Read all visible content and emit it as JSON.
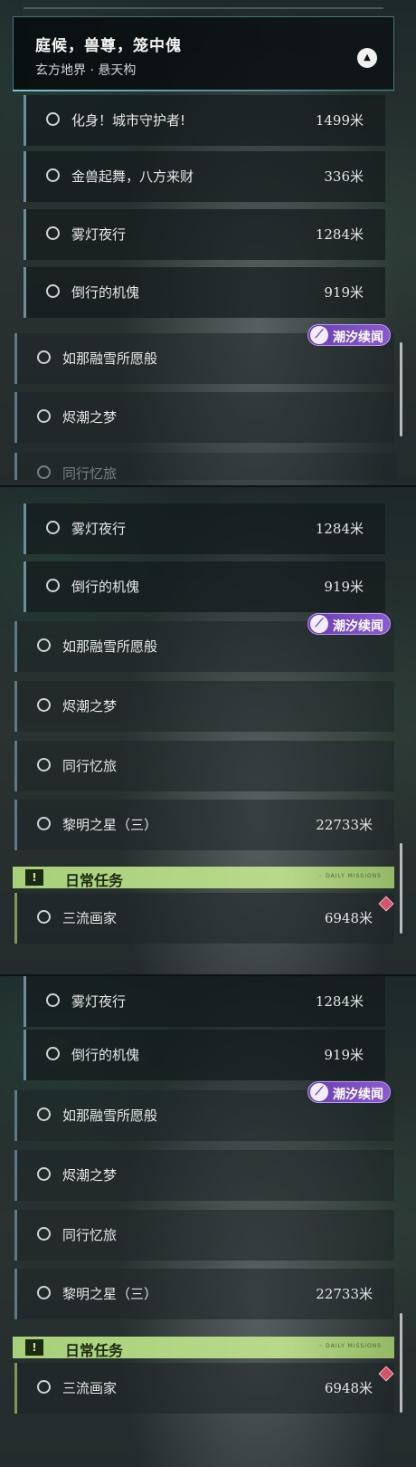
{
  "quest": {
    "title": "庭候，兽尊，笼中傀",
    "subtitle": "玄方地界 · 悬天构",
    "collapse_icon": "▲"
  },
  "badge": {
    "icon": "⟋",
    "label": "潮汐续闻"
  },
  "daily": {
    "icon": "!",
    "label": "日常任务",
    "small_text": "◦ DAILY MISSIONS"
  },
  "panel1": {
    "sub_rows": [
      {
        "label": "化身！城市守护者!",
        "distance": "1499米"
      },
      {
        "label": "金兽起舞，八方来财",
        "distance": "336米"
      },
      {
        "label": "雾灯夜行",
        "distance": "1284米"
      },
      {
        "label": "倒行的机傀",
        "distance": "919米"
      }
    ],
    "main_rows": [
      {
        "label": "如那融雪所愿般",
        "distance": ""
      },
      {
        "label": "烬潮之梦",
        "distance": ""
      }
    ],
    "faded_label": "同行忆旅"
  },
  "panel2": {
    "sub_rows": [
      {
        "label": "雾灯夜行",
        "distance": "1284米"
      },
      {
        "label": "倒行的机傀",
        "distance": "919米"
      }
    ],
    "main_rows": [
      {
        "label": "如那融雪所愿般",
        "distance": ""
      },
      {
        "label": "烬潮之梦",
        "distance": ""
      },
      {
        "label": "同行忆旅",
        "distance": ""
      },
      {
        "label": "黎明之星（三）",
        "distance": "22733米"
      }
    ],
    "daily_rows": [
      {
        "label": "三流画家",
        "distance": "6948米"
      }
    ]
  },
  "panel3": {
    "sub_rows": [
      {
        "label": "雾灯夜行",
        "distance": "1284米"
      },
      {
        "label": "倒行的机傀",
        "distance": "919米"
      }
    ],
    "main_rows": [
      {
        "label": "如那融雪所愿般",
        "distance": ""
      },
      {
        "label": "烬潮之梦",
        "distance": ""
      },
      {
        "label": "同行忆旅",
        "distance": ""
      },
      {
        "label": "黎明之星（三）",
        "distance": "22733米"
      }
    ],
    "daily_rows": [
      {
        "label": "三流画家",
        "distance": "6948米"
      }
    ]
  }
}
